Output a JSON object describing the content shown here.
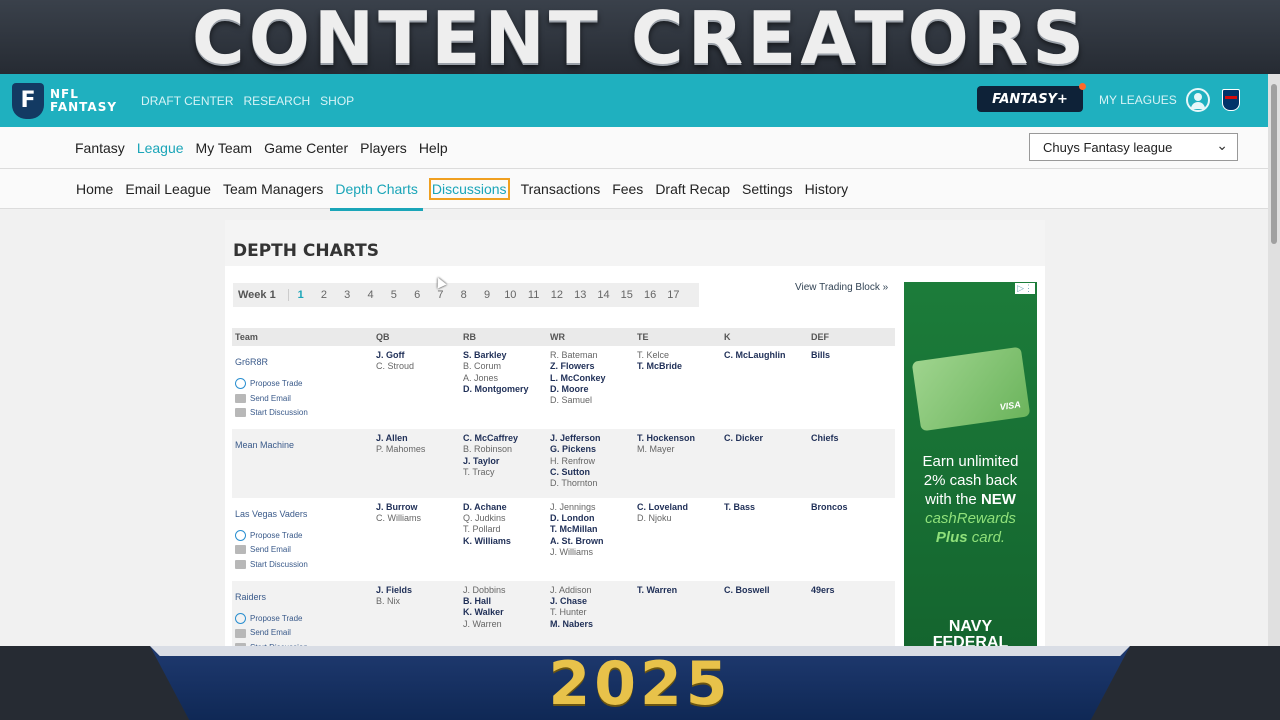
{
  "banner": {
    "top_title": "CONTENT CREATORS",
    "bottom_title": "2025"
  },
  "header": {
    "logo_letter": "F",
    "logo_line1": "NFL",
    "logo_line2": "FANTASY",
    "nav": [
      "DRAFT CENTER",
      "RESEARCH",
      "SHOP"
    ],
    "fantasy_plus": "FANTASY+",
    "my_leagues": "MY LEAGUES",
    "accent": "#1fb0bf"
  },
  "subnav1": {
    "items": [
      "Fantasy",
      "League",
      "My Team",
      "Game Center",
      "Players",
      "Help"
    ],
    "active": "League",
    "league_select": "Chuys Fantasy league"
  },
  "subnav2": {
    "items": [
      "Home",
      "Email League",
      "Team Managers",
      "Depth Charts",
      "Discussions",
      "Transactions",
      "Fees",
      "Draft Recap",
      "Settings",
      "History"
    ],
    "active": "Depth Charts",
    "focused": "Discussions"
  },
  "panel": {
    "title": "DEPTH CHARTS",
    "week_label": "Week 1",
    "weeks": [
      "1",
      "2",
      "3",
      "4",
      "5",
      "6",
      "7",
      "8",
      "9",
      "10",
      "11",
      "12",
      "13",
      "14",
      "15",
      "16",
      "17"
    ],
    "selected_week": "1",
    "trading_block": "View Trading Block »"
  },
  "table": {
    "columns": [
      "Team",
      "QB",
      "RB",
      "WR",
      "TE",
      "K",
      "DEF"
    ],
    "actions": {
      "propose": "Propose Trade",
      "email": "Send Email",
      "discussion": "Start Discussion"
    },
    "rows": [
      {
        "team": "Gr6R8R",
        "actions": true,
        "qb": [
          [
            "J. Goff",
            true
          ],
          [
            "C. Stroud",
            false
          ]
        ],
        "rb": [
          [
            "S. Barkley",
            true
          ],
          [
            "B. Corum",
            false
          ],
          [
            "A. Jones",
            false
          ],
          [
            "D. Montgomery",
            true
          ]
        ],
        "wr": [
          [
            "R. Bateman",
            false
          ],
          [
            "Z. Flowers",
            true
          ],
          [
            "L. McConkey",
            true
          ],
          [
            "D. Moore",
            true
          ],
          [
            "D. Samuel",
            false
          ]
        ],
        "te": [
          [
            "T. Kelce",
            false
          ],
          [
            "T. McBride",
            true
          ]
        ],
        "k": [
          [
            "C. McLaughlin",
            true
          ]
        ],
        "def": [
          [
            "Bills",
            true
          ]
        ]
      },
      {
        "team": "Mean Machine",
        "actions": false,
        "qb": [
          [
            "J. Allen",
            true
          ],
          [
            "P. Mahomes",
            false
          ]
        ],
        "rb": [
          [
            "C. McCaffrey",
            true
          ],
          [
            "B. Robinson",
            false
          ],
          [
            "J. Taylor",
            true
          ],
          [
            "T. Tracy",
            false
          ]
        ],
        "wr": [
          [
            "J. Jefferson",
            true
          ],
          [
            "G. Pickens",
            true
          ],
          [
            "H. Renfrow",
            false
          ],
          [
            "C. Sutton",
            true
          ],
          [
            "D. Thornton",
            false
          ]
        ],
        "te": [
          [
            "T. Hockenson",
            true
          ],
          [
            "M. Mayer",
            false
          ]
        ],
        "k": [
          [
            "C. Dicker",
            true
          ]
        ],
        "def": [
          [
            "Chiefs",
            true
          ]
        ]
      },
      {
        "team": "Las Vegas Vaders",
        "actions": true,
        "qb": [
          [
            "J. Burrow",
            true
          ],
          [
            "C. Williams",
            false
          ]
        ],
        "rb": [
          [
            "D. Achane",
            true
          ],
          [
            "Q. Judkins",
            false
          ],
          [
            "T. Pollard",
            false
          ],
          [
            "K. Williams",
            true
          ]
        ],
        "wr": [
          [
            "J. Jennings",
            false
          ],
          [
            "D. London",
            true
          ],
          [
            "T. McMillan",
            true
          ],
          [
            "A. St. Brown",
            true
          ],
          [
            "J. Williams",
            false
          ]
        ],
        "te": [
          [
            "C. Loveland",
            true
          ],
          [
            "D. Njoku",
            false
          ]
        ],
        "k": [
          [
            "T. Bass",
            true
          ]
        ],
        "def": [
          [
            "Broncos",
            true
          ]
        ]
      },
      {
        "team": "Raiders",
        "actions": true,
        "qb": [
          [
            "J. Fields",
            true
          ],
          [
            "B. Nix",
            false
          ]
        ],
        "rb": [
          [
            "J. Dobbins",
            false
          ],
          [
            "B. Hall",
            true
          ],
          [
            "K. Walker",
            true
          ],
          [
            "J. Warren",
            false
          ]
        ],
        "wr": [
          [
            "J. Addison",
            false
          ],
          [
            "J. Chase",
            true
          ],
          [
            "T. Hunter",
            false
          ],
          [
            "M. Nabers",
            true
          ]
        ],
        "te": [
          [
            "T. Warren",
            true
          ]
        ],
        "k": [
          [
            "C. Boswell",
            true
          ]
        ],
        "def": [
          [
            "49ers",
            true
          ]
        ]
      }
    ]
  },
  "ad": {
    "card_brand": "VISA",
    "copy1": "Earn unlimited",
    "copy2": "2% cash back",
    "copy3a": "with the ",
    "copy3b": "NEW",
    "copy4": "cashRewards",
    "copy5a": "Plus",
    "copy5b": " card.",
    "brand1": "NAVY",
    "brand2": "FEDERAL",
    "adchoice": "▷⋮"
  }
}
